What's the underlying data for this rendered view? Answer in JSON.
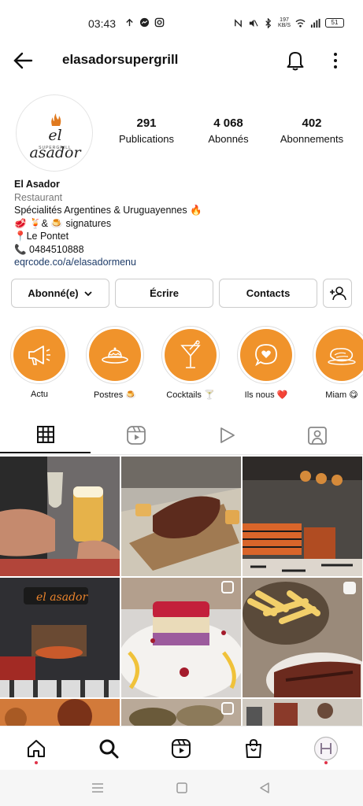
{
  "status_bar": {
    "time": "03:43",
    "net_speed_value": "197",
    "net_speed_unit": "KB/S",
    "battery": "51"
  },
  "header": {
    "username": "elasadorsupergrill"
  },
  "profile": {
    "logo_text": "el asador",
    "logo_sub": "SUPERGRILL",
    "stats": [
      {
        "value": "291",
        "label": "Publications"
      },
      {
        "value": "4 068",
        "label": "Abonnés"
      },
      {
        "value": "402",
        "label": "Abonnements"
      }
    ]
  },
  "bio": {
    "name": "El Asador",
    "category": "Restaurant",
    "line1": "Spécialités Argentines & Uruguayennes 🔥",
    "line2": "🥩 🍹& 🍮 signatures",
    "line3": "📍Le Pontet",
    "line4": "📞 0484510888",
    "link": "eqrcode.co/a/elasadormenu"
  },
  "buttons": {
    "following": "Abonné(e)",
    "message": "Écrire",
    "contacts": "Contacts"
  },
  "highlights": [
    {
      "label": "Actu",
      "icon": "megaphone-icon"
    },
    {
      "label": "Postres 🍮",
      "icon": "dessert-icon"
    },
    {
      "label": "Cocktails 🍸",
      "icon": "cocktail-icon"
    },
    {
      "label": "Ils nous ❤️",
      "icon": "heart-bubble-icon"
    },
    {
      "label": "Miam 😋",
      "icon": "meat-icon"
    }
  ],
  "colors": {
    "highlight_orange": "#f0932b",
    "notification_dot": "#e0334a",
    "link_color": "#1d3b68"
  }
}
